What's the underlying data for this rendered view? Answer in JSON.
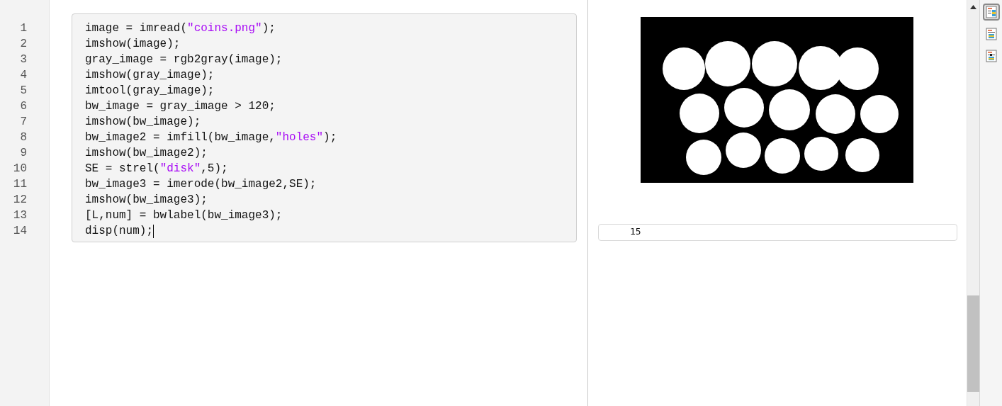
{
  "editor": {
    "lines": [
      {
        "number": "1",
        "cursor": false,
        "tokens": [
          {
            "kind": "code",
            "text": "image = imread("
          },
          {
            "kind": "string",
            "text": "\"coins.png\""
          },
          {
            "kind": "code",
            "text": ");"
          }
        ]
      },
      {
        "number": "2",
        "cursor": false,
        "tokens": [
          {
            "kind": "code",
            "text": "imshow(image);"
          }
        ]
      },
      {
        "number": "3",
        "cursor": false,
        "tokens": [
          {
            "kind": "code",
            "text": "gray_image = rgb2gray(image);"
          }
        ]
      },
      {
        "number": "4",
        "cursor": false,
        "tokens": [
          {
            "kind": "code",
            "text": "imshow(gray_image);"
          }
        ]
      },
      {
        "number": "5",
        "cursor": false,
        "tokens": [
          {
            "kind": "code",
            "text": "imtool(gray_image);"
          }
        ]
      },
      {
        "number": "6",
        "cursor": false,
        "tokens": [
          {
            "kind": "code",
            "text": "bw_image = gray_image > 120;"
          }
        ]
      },
      {
        "number": "7",
        "cursor": false,
        "tokens": [
          {
            "kind": "code",
            "text": "imshow(bw_image);"
          }
        ]
      },
      {
        "number": "8",
        "cursor": false,
        "tokens": [
          {
            "kind": "code",
            "text": "bw_image2 = imfill(bw_image,"
          },
          {
            "kind": "string",
            "text": "\"holes\""
          },
          {
            "kind": "code",
            "text": ");"
          }
        ]
      },
      {
        "number": "9",
        "cursor": false,
        "tokens": [
          {
            "kind": "code",
            "text": "imshow(bw_image2);"
          }
        ]
      },
      {
        "number": "10",
        "cursor": false,
        "tokens": [
          {
            "kind": "code",
            "text": "SE = strel("
          },
          {
            "kind": "string",
            "text": "\"disk\""
          },
          {
            "kind": "code",
            "text": ",5);"
          }
        ]
      },
      {
        "number": "11",
        "cursor": false,
        "tokens": [
          {
            "kind": "code",
            "text": "bw_image3 = imerode(bw_image2,SE);"
          }
        ]
      },
      {
        "number": "12",
        "cursor": false,
        "tokens": [
          {
            "kind": "code",
            "text": "imshow(bw_image3);"
          }
        ]
      },
      {
        "number": "13",
        "cursor": false,
        "tokens": [
          {
            "kind": "code",
            "text": "[L,num] = bwlabel(bw_image3);"
          }
        ]
      },
      {
        "number": "14",
        "cursor": true,
        "tokens": [
          {
            "kind": "code",
            "text": "disp(num);"
          }
        ]
      }
    ]
  },
  "output": {
    "text": "15"
  },
  "view_buttons": [
    {
      "kind": "right",
      "selected": true
    },
    {
      "kind": "inline",
      "selected": false
    },
    {
      "kind": "hide",
      "selected": false
    }
  ]
}
